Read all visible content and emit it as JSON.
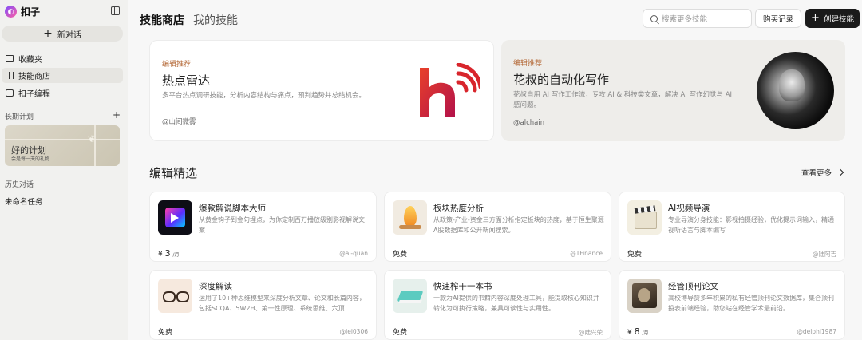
{
  "sidebar": {
    "brand": "扣子",
    "new_chat": "新对话",
    "nav": [
      {
        "label": "收藏夹",
        "icon": "folder-icon"
      },
      {
        "label": "技能商店",
        "icon": "books-icon",
        "active": true
      },
      {
        "label": "扣子编程",
        "icon": "monitor-icon"
      }
    ],
    "long_term_label": "长期计划",
    "plan_card": {
      "title": "好的计划",
      "subtitle": "会是每一天的礼物"
    },
    "history_label": "历史对话",
    "history_items": [
      "未命名任务"
    ]
  },
  "header": {
    "tabs": [
      {
        "label": "技能商店",
        "active": true
      },
      {
        "label": "我的技能",
        "active": false
      }
    ],
    "search_placeholder": "搜索更多技能",
    "purchase_history": "购买记录",
    "create_skill": "创建技能"
  },
  "featured": [
    {
      "tag": "编辑推荐",
      "title": "热点雷达",
      "desc": "多平台热点调研技能，分析内容结构与痛点，预判趋势并总结机会。",
      "author": "@山间微雾"
    },
    {
      "tag": "编辑推荐",
      "title": "花叔的自动化写作",
      "desc": "花叔自用 AI 写作工作流，专攻 AI & 科技类文章，解决 AI 写作幻觉与 AI 感问题。",
      "author": "@alchain"
    }
  ],
  "section": {
    "title": "编辑精选",
    "see_more": "查看更多"
  },
  "skills": [
    {
      "name": "爆款解说脚本大师",
      "desc": "从黄金钩子到金句埋点，为你定制百万播放级别影视解说文案",
      "price": "3",
      "price_prefix": "¥",
      "price_unit": "/月",
      "author": "@ai-quan"
    },
    {
      "name": "板块热度分析",
      "desc": "从政策-产业-资金三方面分析指定板块的热度，基于恒生聚源A股数据库和公开新闻搜索。",
      "price": "免费",
      "price_prefix": "",
      "price_unit": "",
      "author": "@TFinance"
    },
    {
      "name": "AI视频导演",
      "desc": "专业导演分身技能：影视拍摄经验，优化提示词输入，精通视听语言与脚本编写",
      "price": "免费",
      "price_prefix": "",
      "price_unit": "",
      "author": "@陆阿吉"
    },
    {
      "name": "深度解读",
      "desc": "运用了10+种思维模型来深度分析文章、论文和长篇内容，包括SCQA、5W2H、第一性原理、系统思维、六顶...",
      "price": "免费",
      "price_prefix": "",
      "price_unit": "",
      "author": "@lei0306"
    },
    {
      "name": "快速榨干一本书",
      "desc": "一款为AI提供的书籍内容深度处理工具，能提取核心知识并转化为可执行策略，兼具可读性与实用性。",
      "price": "免费",
      "price_prefix": "",
      "price_unit": "",
      "author": "@陆兴荣"
    },
    {
      "name": "经管顶刊论文",
      "desc": "高校博导赞多年积累的私有经管顶刊论文数据库，集合顶刊投表前端经验，助您站在经管学术最前沿。",
      "price": "8",
      "price_prefix": "¥",
      "price_unit": "/月",
      "author": "@delphi1987"
    }
  ]
}
